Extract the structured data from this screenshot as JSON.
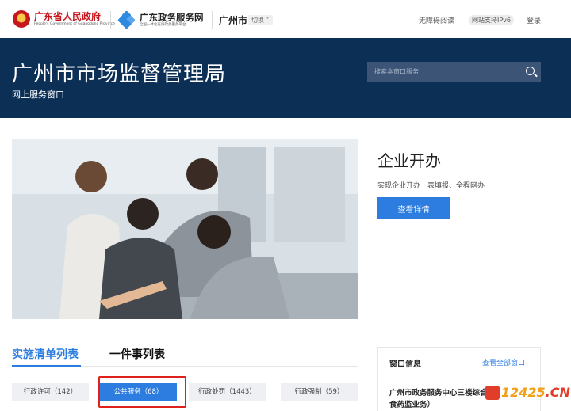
{
  "header": {
    "gov_name": "广东省人民政府",
    "gov_en": "People's Government of Guangdong Province",
    "portal_name": "广东政务服务网",
    "portal_sub": "全国一体化在线政务服务平台",
    "city": "广州市",
    "switch_label": "切换",
    "accessibility": "无障碍阅读",
    "ipv6": "网站支持IPv6",
    "login": "登录"
  },
  "banner": {
    "department": "广州市市场监督管理局",
    "subtitle": "网上服务窗口",
    "search_placeholder": "搜索本窗口服务"
  },
  "feature": {
    "title": "企业开办",
    "description": "实现企业开办一表填报、全程网办",
    "button": "查看详情"
  },
  "tabs": [
    {
      "label": "实施清单列表",
      "active": true
    },
    {
      "label": "一件事列表",
      "active": false
    }
  ],
  "categories": [
    {
      "label": "行政许可（142）",
      "active": false
    },
    {
      "label": "公共服务（68）",
      "active": true
    },
    {
      "label": "行政处罚（1443）",
      "active": false
    },
    {
      "label": "行政强制（59）",
      "active": false
    }
  ],
  "window_info": {
    "title": "窗口信息",
    "view_all": "查看全部窗口",
    "text": "广州市政务服务中心三楼综合食药监业务）"
  },
  "watermark": {
    "part_a": "12425",
    "part_b": ".CN"
  },
  "colors": {
    "banner": "#0c2f56",
    "accent": "#2d7de0",
    "gov_red": "#c8161d",
    "highlight": "#e0201b"
  }
}
